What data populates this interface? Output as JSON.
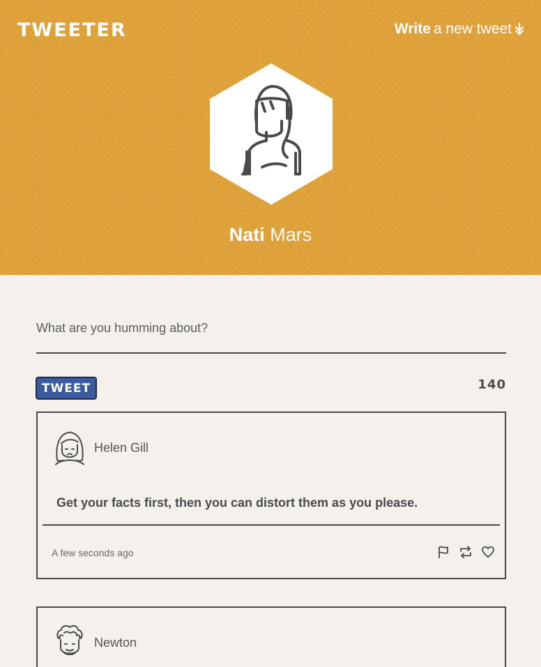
{
  "header": {
    "logo": "TWEETER",
    "write_bold": "Write",
    "write_rest": "a new tweet",
    "write_arrow_icon": "double-arrow-down-icon",
    "background_color": "#e0a33b"
  },
  "profile": {
    "first_name": "Nati",
    "last_name": "Mars",
    "avatar_icon": "woman-avatar-icon"
  },
  "compose": {
    "placeholder": "What are you humming about?",
    "value": "",
    "tweet_button": "TWEET",
    "char_count": "140",
    "button_color": "#3a5ba0"
  },
  "tweets": [
    {
      "author": "Helen Gill",
      "avatar_icon": "girl-avatar-icon",
      "text": "Get your facts first, then you can distort them as you please.",
      "time": "A few seconds ago",
      "actions": [
        "flag-icon",
        "retweet-icon",
        "heart-icon"
      ]
    },
    {
      "author": "Newton",
      "avatar_icon": "curly-hair-man-avatar-icon"
    }
  ]
}
